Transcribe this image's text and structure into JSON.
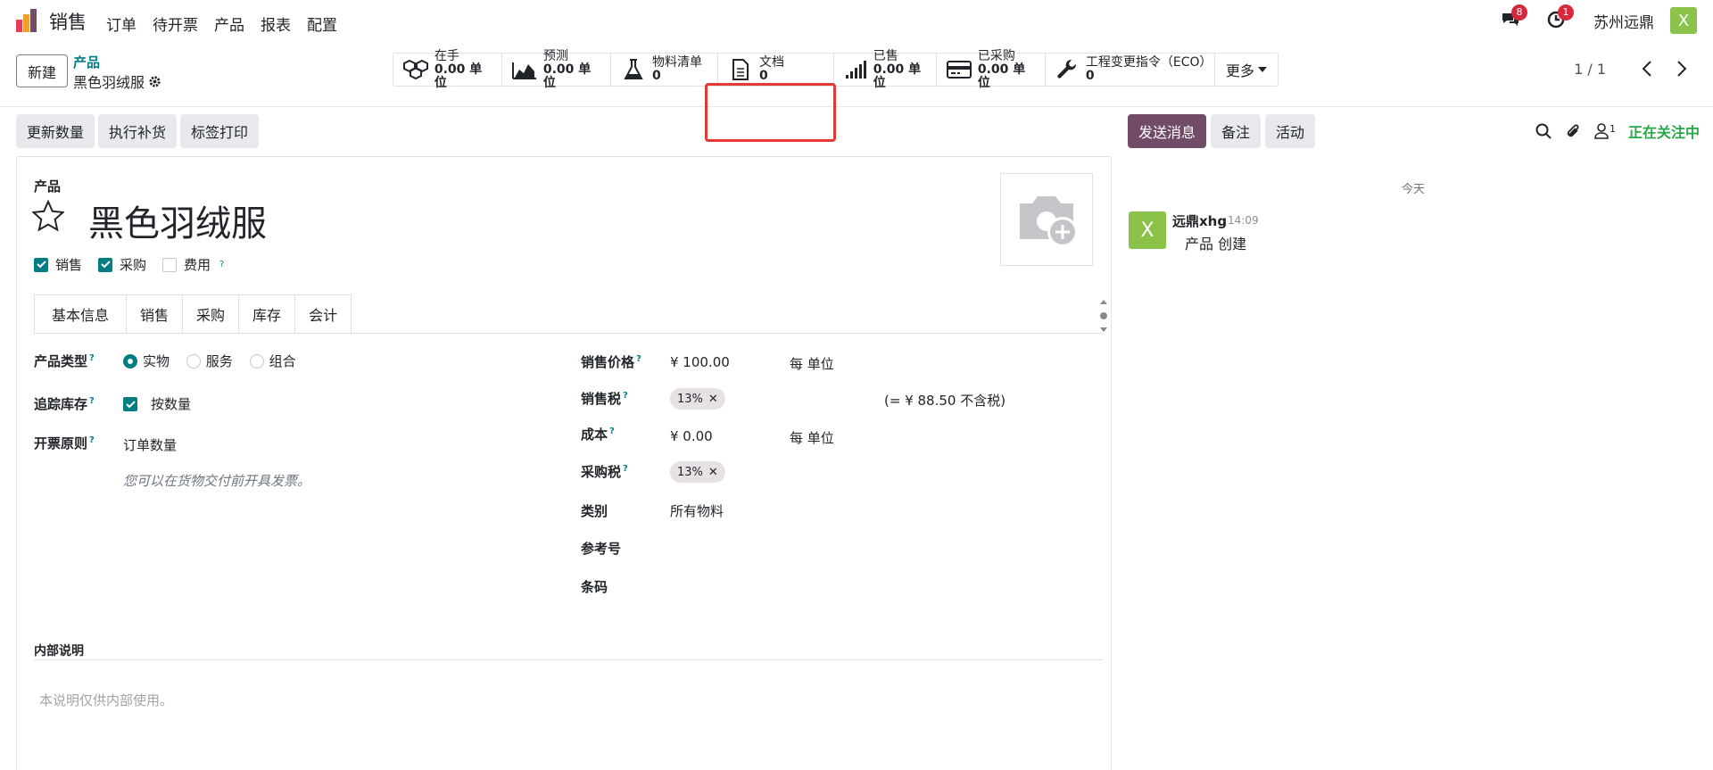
{
  "navbar": {
    "app_name": "销售",
    "menu": [
      "订单",
      "待开票",
      "产品",
      "报表",
      "配置"
    ],
    "messages_count": "8",
    "activities_count": "1",
    "company": "苏州远鼎",
    "avatar_letter": "X"
  },
  "control_panel": {
    "new_button": "新建",
    "breadcrumb_parent": "产品",
    "breadcrumb_current": "黑色羽绒服",
    "pager": "1 / 1",
    "smart_buttons": [
      {
        "label": "在手",
        "value": "0.00 单位",
        "icon": "cubes-icon"
      },
      {
        "label": "预测",
        "value": "0.00 单位",
        "icon": "area-chart-icon"
      },
      {
        "label": "物料清单",
        "value": "0",
        "icon": "flask-icon"
      },
      {
        "label": "文档",
        "value": "0",
        "icon": "document-icon"
      },
      {
        "label": "已售",
        "value": "0.00 单位",
        "icon": "signal-icon"
      },
      {
        "label": "已采购",
        "value": "0.00 单位",
        "icon": "credit-card-icon"
      },
      {
        "label": "工程变更指令（ECO）",
        "value": "0",
        "icon": "wrench-icon"
      }
    ],
    "more_label": "更多"
  },
  "action_buttons": [
    "更新数量",
    "执行补货",
    "标签打印"
  ],
  "chatter_buttons": {
    "send": "发送消息",
    "note": "备注",
    "activity": "活动",
    "followers_count": "1",
    "following": "正在关注中"
  },
  "form": {
    "name_label": "产品",
    "name": "黑色羽绒服",
    "checkboxes": [
      {
        "label": "销售",
        "checked": true
      },
      {
        "label": "采购",
        "checked": true
      },
      {
        "label": "费用",
        "checked": false
      }
    ],
    "tabs": [
      "基本信息",
      "销售",
      "采购",
      "库存",
      "会计"
    ],
    "left": {
      "product_type_label": "产品类型",
      "product_type_options": [
        "实物",
        "服务",
        "组合"
      ],
      "track_label": "追踪库存",
      "track_value": "按数量",
      "invoice_policy_label": "开票原则",
      "invoice_policy_value": "订单数量",
      "invoice_hint": "您可以在货物交付前开具发票。"
    },
    "right": {
      "sale_price_label": "销售价格",
      "sale_price": "¥ 100.00",
      "sale_price_unit": "每 单位",
      "sale_tax_label": "销售税",
      "sale_tax": "13%",
      "tax_excluded": "(= ¥ 88.50 不含税)",
      "cost_label": "成本",
      "cost": "¥ 0.00",
      "cost_unit": "每 单位",
      "purchase_tax_label": "采购税",
      "purchase_tax": "13%",
      "category_label": "类别",
      "category": "所有物料",
      "reference_label": "参考号",
      "barcode_label": "条码"
    },
    "notes_label": "内部说明",
    "notes_placeholder": "本说明仅供内部使用。"
  },
  "chatter": {
    "today": "今天",
    "message": {
      "avatar": "X",
      "author": "远鼎xhg",
      "time": "14:09",
      "body": "产品 创建"
    }
  }
}
